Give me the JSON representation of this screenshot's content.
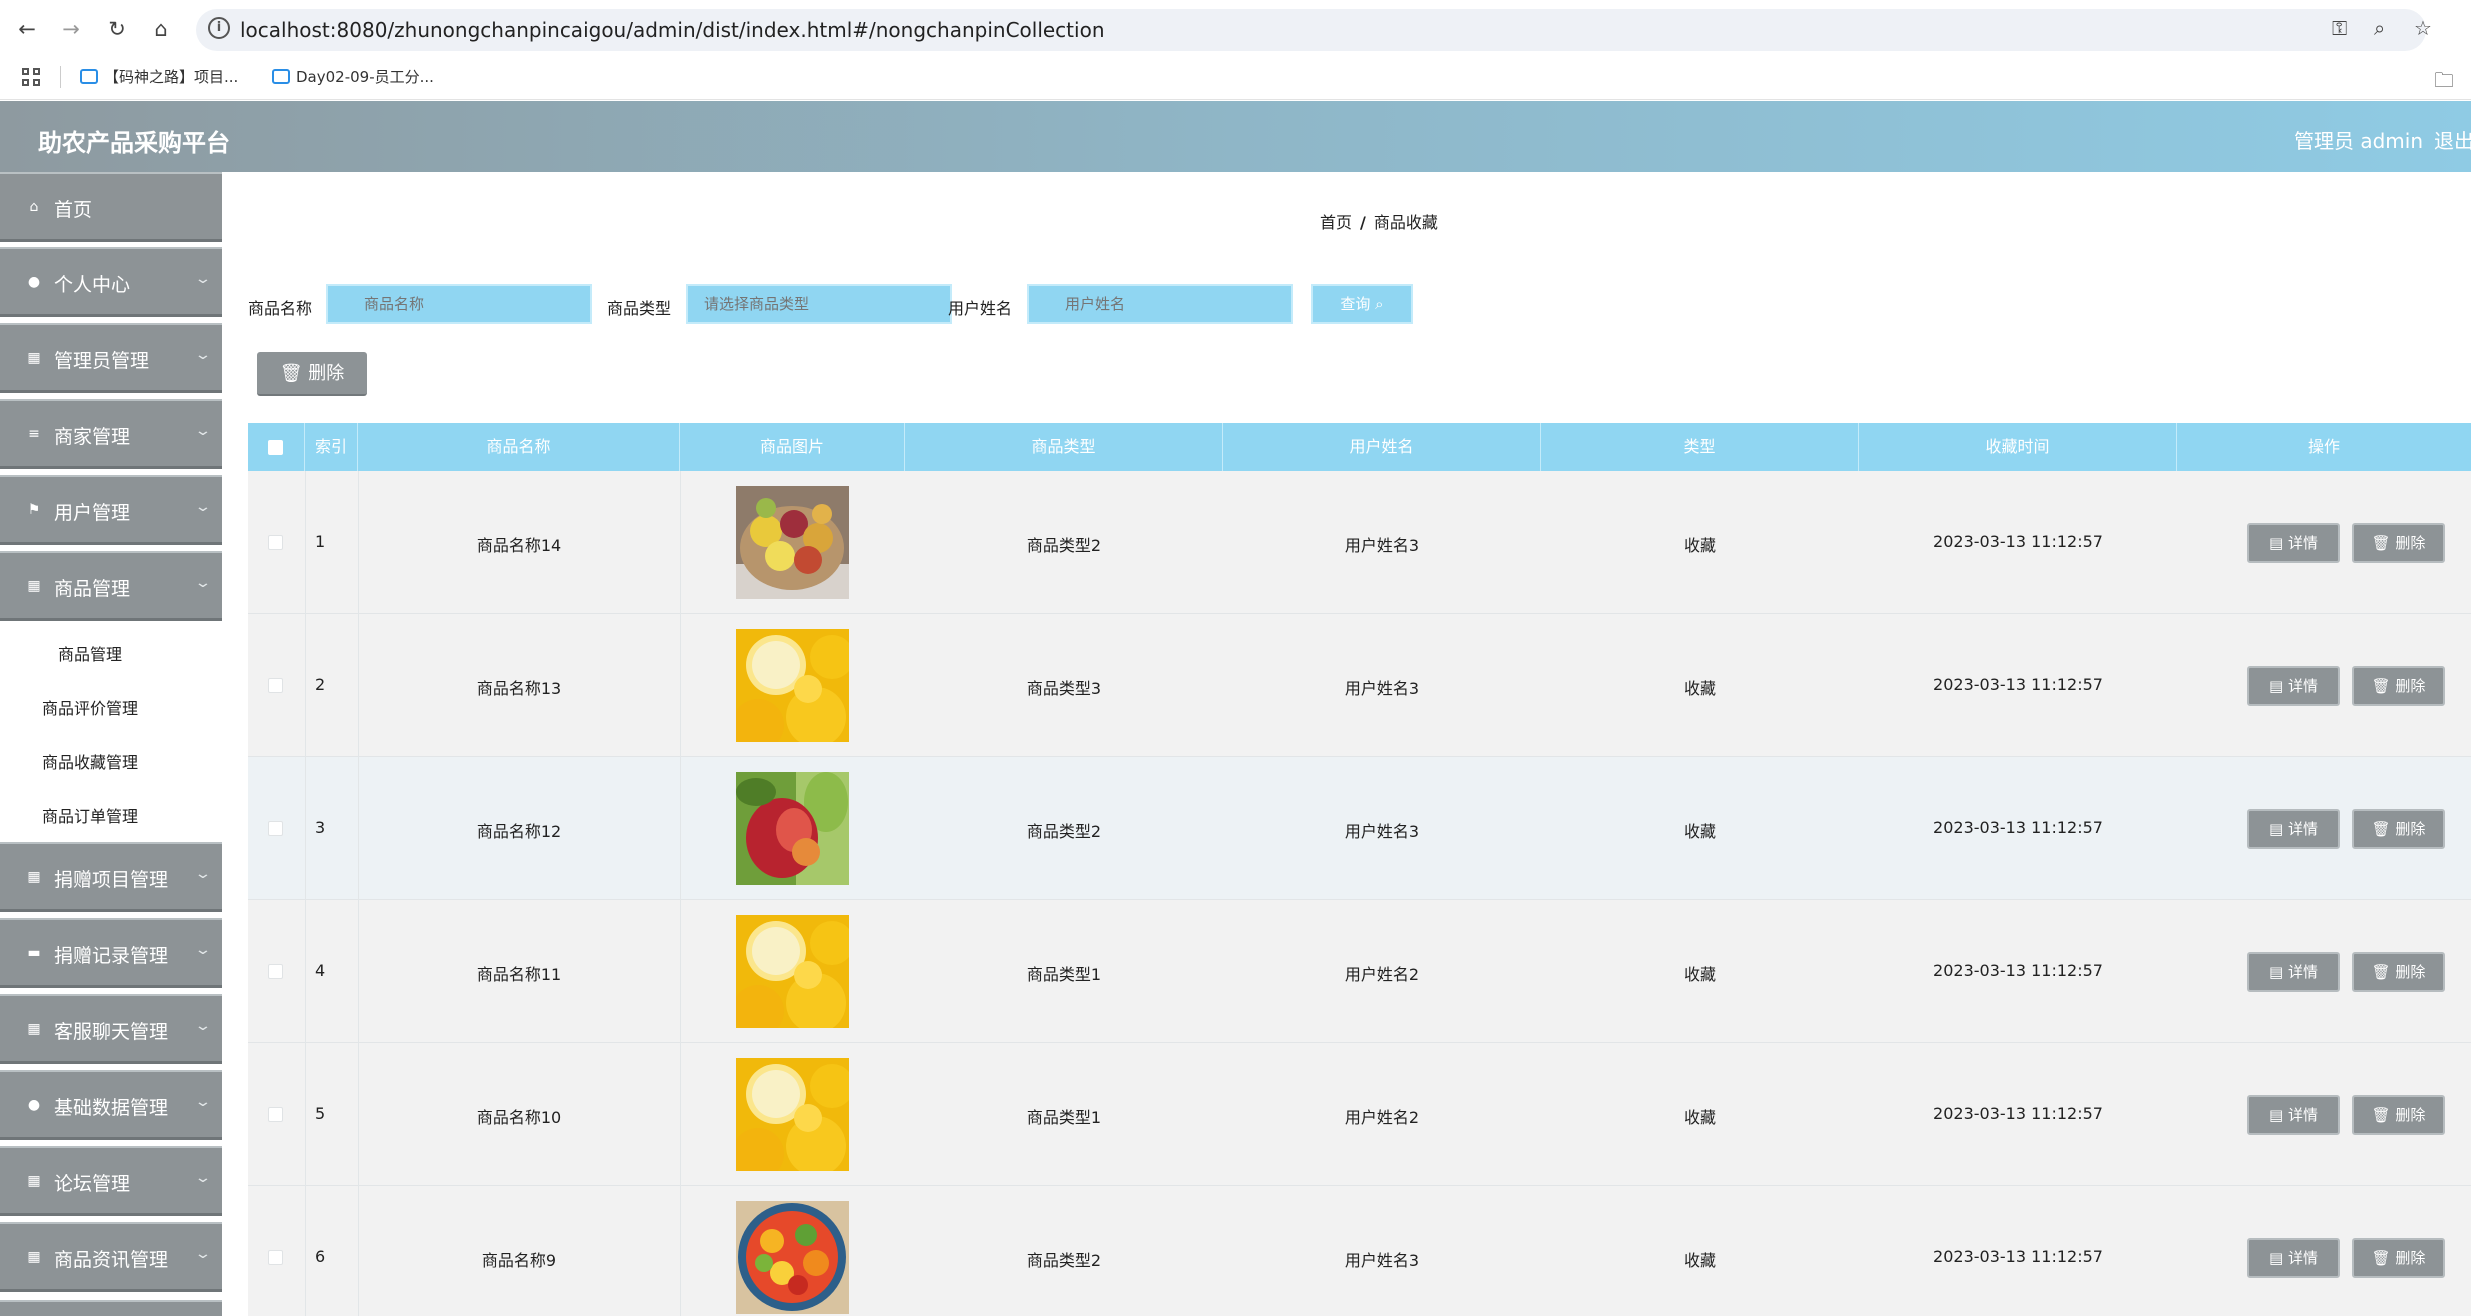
{
  "browser": {
    "url": "localhost:8080/zhunongchanpincaigou/admin/dist/index.html#/nongchanpinCollection",
    "bookmarks": [
      "【码神之路】项目...",
      "Day02-09-员工分..."
    ]
  },
  "header": {
    "title": "助农产品采购平台",
    "admin_label": "管理员 admin",
    "logout_label": "退出"
  },
  "sidebar": {
    "items": [
      {
        "label": "首页",
        "icon": "home-icon"
      },
      {
        "label": "个人中心",
        "icon": "user-icon"
      },
      {
        "label": "管理员管理",
        "icon": "grid-icon"
      },
      {
        "label": "商家管理",
        "icon": "list-icon"
      },
      {
        "label": "用户管理",
        "icon": "flag-icon"
      },
      {
        "label": "商品管理",
        "icon": "grid-icon"
      },
      {
        "label": "捐赠项目管理",
        "icon": "grid-icon"
      },
      {
        "label": "捐赠记录管理",
        "icon": "ticket-icon"
      },
      {
        "label": "客服聊天管理",
        "icon": "grid-icon"
      },
      {
        "label": "基础数据管理",
        "icon": "user-icon"
      },
      {
        "label": "论坛管理",
        "icon": "grid-icon"
      },
      {
        "label": "商品资讯管理",
        "icon": "grid-icon"
      }
    ],
    "subitems": [
      "商品管理",
      "商品评价管理",
      "商品收藏管理",
      "商品订单管理"
    ]
  },
  "breadcrumb": {
    "home": "首页",
    "sep": "/",
    "current": "商品收藏"
  },
  "search": {
    "name_label": "商品名称",
    "name_placeholder": "商品名称",
    "type_label": "商品类型",
    "type_placeholder": "请选择商品类型",
    "user_label": "用户姓名",
    "user_placeholder": "用户姓名",
    "query_label": "查询 ⌕"
  },
  "toolbar": {
    "delete_label": "删除"
  },
  "table": {
    "headers": [
      "索引",
      "商品名称",
      "商品图片",
      "商品类型",
      "用户姓名",
      "类型",
      "收藏时间",
      "操作"
    ],
    "detail_label": "详情",
    "delete_label": "删除",
    "rows": [
      {
        "index": "1",
        "name": "商品名称14",
        "type": "商品类型2",
        "user": "用户姓名3",
        "kind": "收藏",
        "time": "2023-03-13 11:12:57"
      },
      {
        "index": "2",
        "name": "商品名称13",
        "type": "商品类型3",
        "user": "用户姓名3",
        "kind": "收藏",
        "time": "2023-03-13 11:12:57"
      },
      {
        "index": "3",
        "name": "商品名称12",
        "type": "商品类型2",
        "user": "用户姓名3",
        "kind": "收藏",
        "time": "2023-03-13 11:12:57"
      },
      {
        "index": "4",
        "name": "商品名称11",
        "type": "商品类型1",
        "user": "用户姓名2",
        "kind": "收藏",
        "time": "2023-03-13 11:12:57"
      },
      {
        "index": "5",
        "name": "商品名称10",
        "type": "商品类型1",
        "user": "用户姓名2",
        "kind": "收藏",
        "time": "2023-03-13 11:12:57"
      },
      {
        "index": "6",
        "name": "商品名称9",
        "type": "商品类型2",
        "user": "用户姓名3",
        "kind": "收藏",
        "time": "2023-03-13 11:12:57"
      }
    ]
  }
}
